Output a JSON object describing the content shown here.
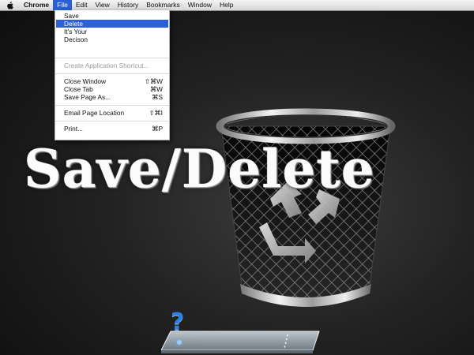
{
  "menubar": {
    "app_name": "Chrome",
    "items": [
      {
        "label": "File"
      },
      {
        "label": "Edit"
      },
      {
        "label": "View"
      },
      {
        "label": "History"
      },
      {
        "label": "Bookmarks"
      },
      {
        "label": "Window"
      },
      {
        "label": "Help"
      }
    ],
    "active_menu": "File"
  },
  "file_menu": {
    "top_items": [
      {
        "label": "Save"
      },
      {
        "label": "Delete",
        "selected": true
      },
      {
        "label": "It's Your"
      },
      {
        "label": "Decison"
      }
    ],
    "create_shortcut": {
      "label": "Create Application Shortcut...",
      "disabled": true
    },
    "close_window": {
      "label": "Close Window",
      "shortcut": "⇧⌘W"
    },
    "close_tab": {
      "label": "Close Tab",
      "shortcut": "⌘W"
    },
    "save_page": {
      "label": "Save Page As...",
      "shortcut": "⌘S"
    },
    "email_page": {
      "label": "Email Page Location",
      "shortcut": "⇧⌘I"
    },
    "print": {
      "label": "Print...",
      "shortcut": "⌘P"
    }
  },
  "headline": {
    "left": "Save",
    "divider": "/",
    "right": "Delete"
  },
  "dock": {
    "icon": "question-mark-icon",
    "glyph": "?"
  },
  "colors": {
    "selection": "#2a5fd6",
    "background": "#1e1e1e",
    "title_text": "#fbfbfb"
  }
}
